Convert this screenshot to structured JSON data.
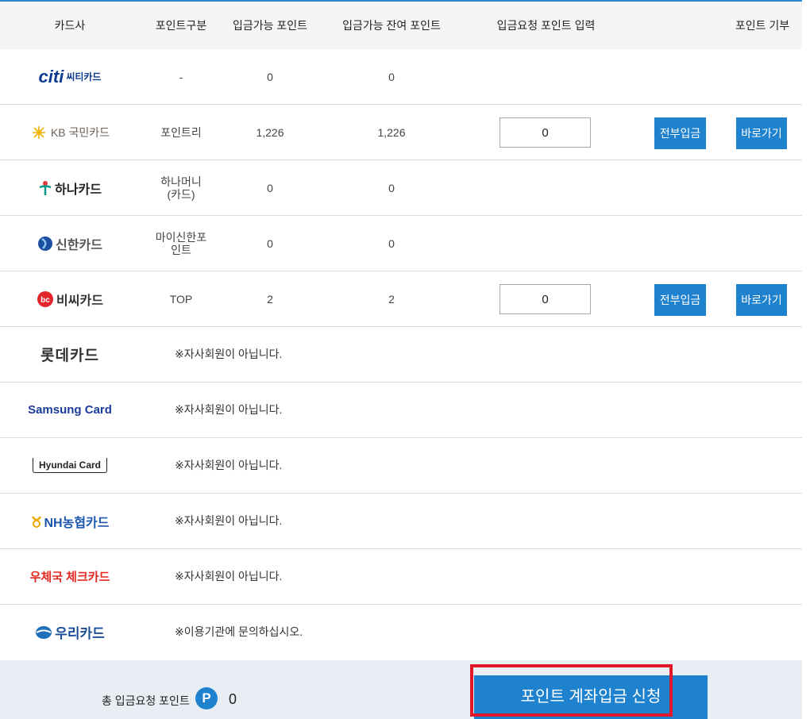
{
  "header": {
    "card_company": "카드사",
    "point_type": "포인트구분",
    "available_points": "입금가능 포인트",
    "remaining_points": "입금가능 잔여 포인트",
    "request_input": "입금요청 포인트 입력",
    "donate": "포인트 기부"
  },
  "rows": [
    {
      "logo": "citi 씨티카드",
      "logo_text": "씨티카드",
      "type": "-",
      "available": "0",
      "remaining": "0"
    },
    {
      "logo": "KB국민카드",
      "logo_text": "KB 국민카드",
      "type": "포인트리",
      "available": "1,226",
      "remaining": "1,226",
      "input_value": "0",
      "btn_all": "전부입금",
      "btn_go": "바로가기"
    },
    {
      "logo": "하나카드",
      "logo_text": "하나카드",
      "type_line1": "하나머니",
      "type_line2": "(카드)",
      "available": "0",
      "remaining": "0"
    },
    {
      "logo": "신한카드",
      "logo_text": "신한카드",
      "type_line1": "마이신한포",
      "type_line2": "인트",
      "available": "0",
      "remaining": "0"
    },
    {
      "logo": "비씨카드",
      "logo_text": "비씨카드",
      "type": "TOP",
      "available": "2",
      "remaining": "2",
      "input_value": "0",
      "btn_all": "전부입금",
      "btn_go": "바로가기"
    },
    {
      "logo": "롯데카드",
      "logo_text": "롯데카드",
      "message": "※자사회원이 아닙니다."
    },
    {
      "logo": "Samsung Card",
      "logo_text": "Samsung Card",
      "message": "※자사회원이 아닙니다."
    },
    {
      "logo": "Hyundai Card",
      "logo_text": "Hyundai Card",
      "message": "※자사회원이 아닙니다."
    },
    {
      "logo": "NH농협카드",
      "logo_text": "NH농협카드",
      "message": "※자사회원이 아닙니다."
    },
    {
      "logo": "우체국 체크카드",
      "logo_text": "우체국 체크카드",
      "message": "※자사회원이 아닙니다."
    },
    {
      "logo": "우리카드",
      "logo_text": "우리카드",
      "message": "※이용기관에 문의하십시오."
    }
  ],
  "footer": {
    "total_label": "총 입금요청 포인트",
    "badge": "P",
    "total_value": "0",
    "apply_button": "포인트 계좌입금 신청"
  },
  "colors": {
    "accent": "#1e82cf",
    "highlight": "#e0182a",
    "header_bg": "#f5f5f5",
    "footer_bg": "#e9eef4"
  }
}
